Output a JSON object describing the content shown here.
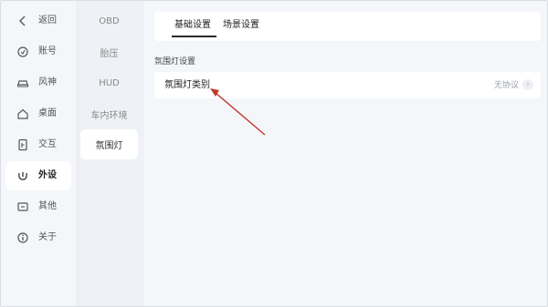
{
  "nav": {
    "items": [
      {
        "label": "返回",
        "icon": "back-chevron-icon"
      },
      {
        "label": "账号",
        "icon": "account-icon"
      },
      {
        "label": "风神",
        "icon": "car-icon"
      },
      {
        "label": "桌面",
        "icon": "home-icon"
      },
      {
        "label": "交互",
        "icon": "interaction-icon"
      },
      {
        "label": "外设",
        "icon": "peripheral-icon"
      },
      {
        "label": "其他",
        "icon": "other-icon"
      },
      {
        "label": "关于",
        "icon": "info-icon"
      }
    ],
    "active_index": 5
  },
  "subnav": {
    "items": [
      "OBD",
      "胎压",
      "HUD",
      "车内环境",
      "氛围灯"
    ],
    "active_index": 4
  },
  "tabs": [
    "基础设置",
    "场景设置"
  ],
  "section_title": "氛围灯设置",
  "row": {
    "label": "氛围灯类别",
    "value": "无协议",
    "chevron_icon": "chevron-right-icon"
  },
  "colors": {
    "annotation_arrow": "#c0392b",
    "background": "#f4f6fa",
    "card": "#ffffff"
  }
}
